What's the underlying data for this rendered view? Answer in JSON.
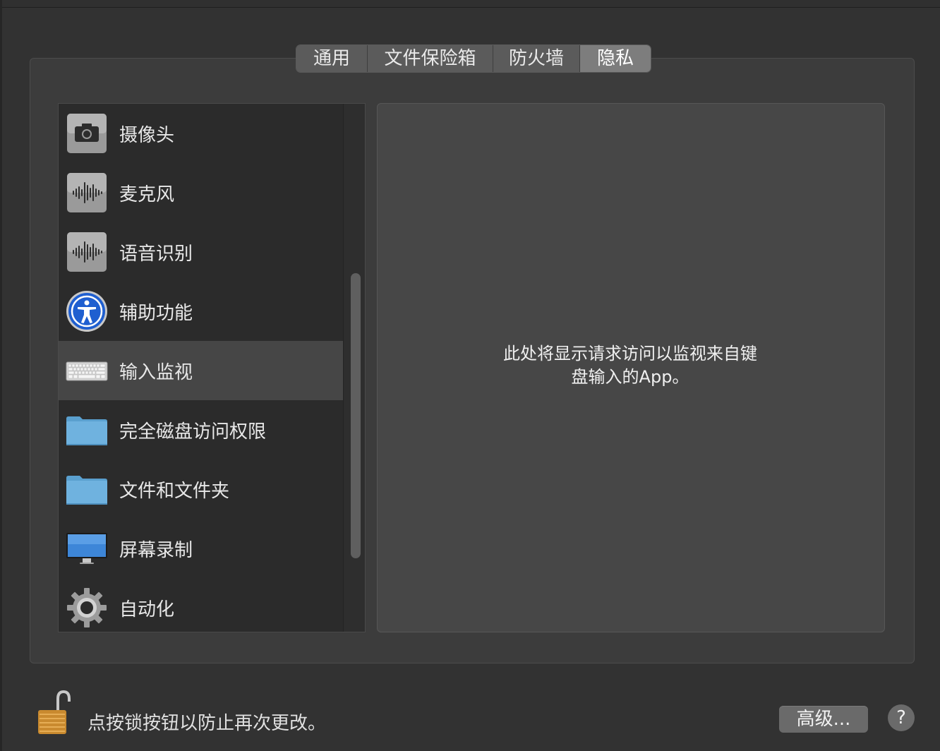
{
  "tabs": [
    {
      "label": "通用",
      "selected": false
    },
    {
      "label": "文件保险箱",
      "selected": false
    },
    {
      "label": "防火墙",
      "selected": false
    },
    {
      "label": "隐私",
      "selected": true
    }
  ],
  "privacy_list": {
    "items": [
      {
        "label": "摄像头",
        "icon": "camera-icon",
        "selected": false
      },
      {
        "label": "麦克风",
        "icon": "microphone-waveform-icon",
        "selected": false
      },
      {
        "label": "语音识别",
        "icon": "speech-waveform-icon",
        "selected": false
      },
      {
        "label": "辅助功能",
        "icon": "accessibility-icon",
        "selected": false
      },
      {
        "label": "输入监视",
        "icon": "keyboard-icon",
        "selected": true
      },
      {
        "label": "完全磁盘访问权限",
        "icon": "folder-icon",
        "selected": false
      },
      {
        "label": "文件和文件夹",
        "icon": "folder-icon",
        "selected": false
      },
      {
        "label": "屏幕录制",
        "icon": "display-icon",
        "selected": false
      },
      {
        "label": "自动化",
        "icon": "gear-icon",
        "selected": false
      }
    ]
  },
  "detail": {
    "message_line1": "此处将显示请求访问以监视来自键",
    "message_line2": "盘输入的App。"
  },
  "footer": {
    "lock_text": "点按锁按钮以防止再次更改。",
    "advanced_label": "高级...",
    "help_label": "?"
  },
  "colors": {
    "background": "#323232",
    "panel": "#3c3c3c",
    "selected_row": "#464646",
    "selected_tab": "#7d7d7d"
  }
}
